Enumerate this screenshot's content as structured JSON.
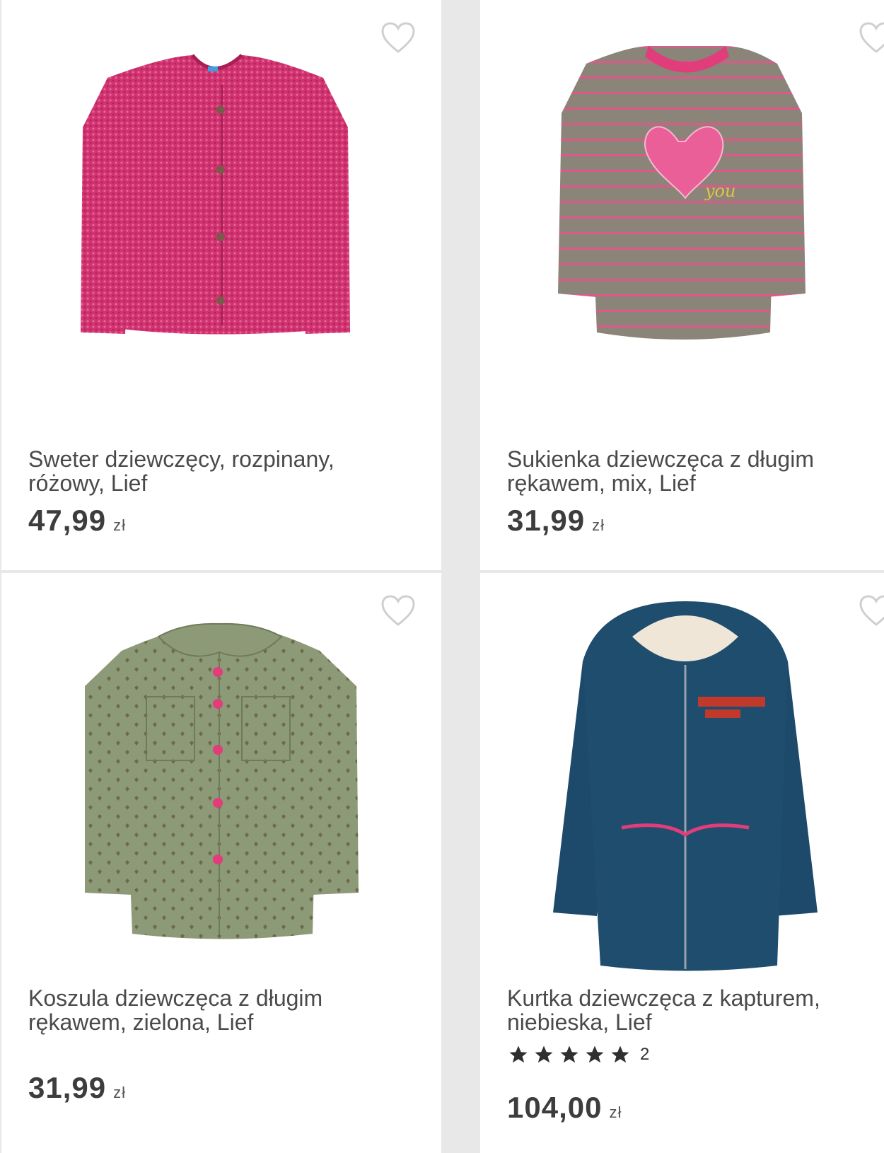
{
  "products": [
    {
      "title": "Sweter dziewczęcy, rozpinany, różowy, Lief",
      "price": "47,99",
      "currency": "zł"
    },
    {
      "title": "Sukienka dziewczęca z długim rękawem, mix, Lief",
      "price": "31,99",
      "currency": "zł"
    },
    {
      "title": "Koszula dziewczęca z długim rękawem, zielona, Lief",
      "price": "31,99",
      "currency": "zł"
    },
    {
      "title": "Kurtka dziewczęca z kapturem, niebieska, Lief",
      "price": "104,00",
      "currency": "zł",
      "rating_count": "2",
      "rating_stars": 5
    }
  ],
  "colors": {
    "heart_outline": "#cfcfcf",
    "star": "#2f2f2f",
    "text": "#4a4a4a"
  },
  "icons": {
    "favorite": "heart-outline-icon",
    "rating": "star-icon"
  }
}
